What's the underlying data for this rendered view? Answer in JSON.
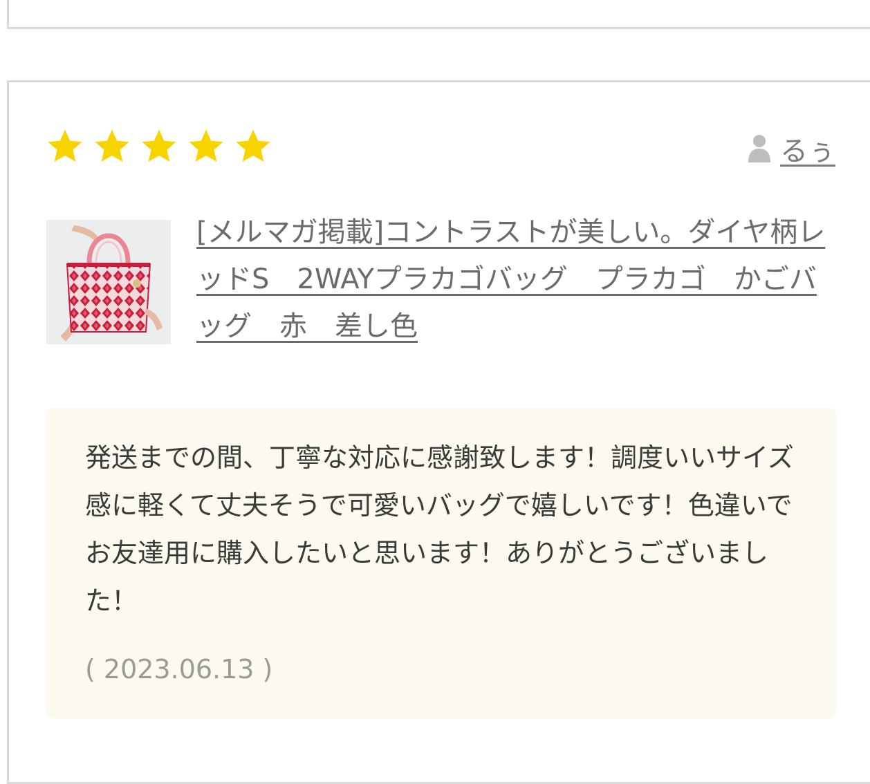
{
  "review": {
    "rating": 5,
    "max_rating": 5,
    "star_color": "#f7d400",
    "reviewer_name": "るぅ",
    "product_title": "[メルマガ掲載]コントラストが美しい。ダイヤ柄レッドS　2WAYプラカゴバッグ　プラカゴ　かごバッグ　赤　差し色",
    "comment": "発送までの間、丁寧な対応に感謝致します！調度いいサイズ感に軽くて丈夫そうで可愛いバッグで嬉しいです！色違いでお友達用に購入したいと思います！ありがとうございました！",
    "date": "( 2023.06.13 )",
    "icons": {
      "star": "star-icon",
      "user": "user-icon"
    }
  }
}
